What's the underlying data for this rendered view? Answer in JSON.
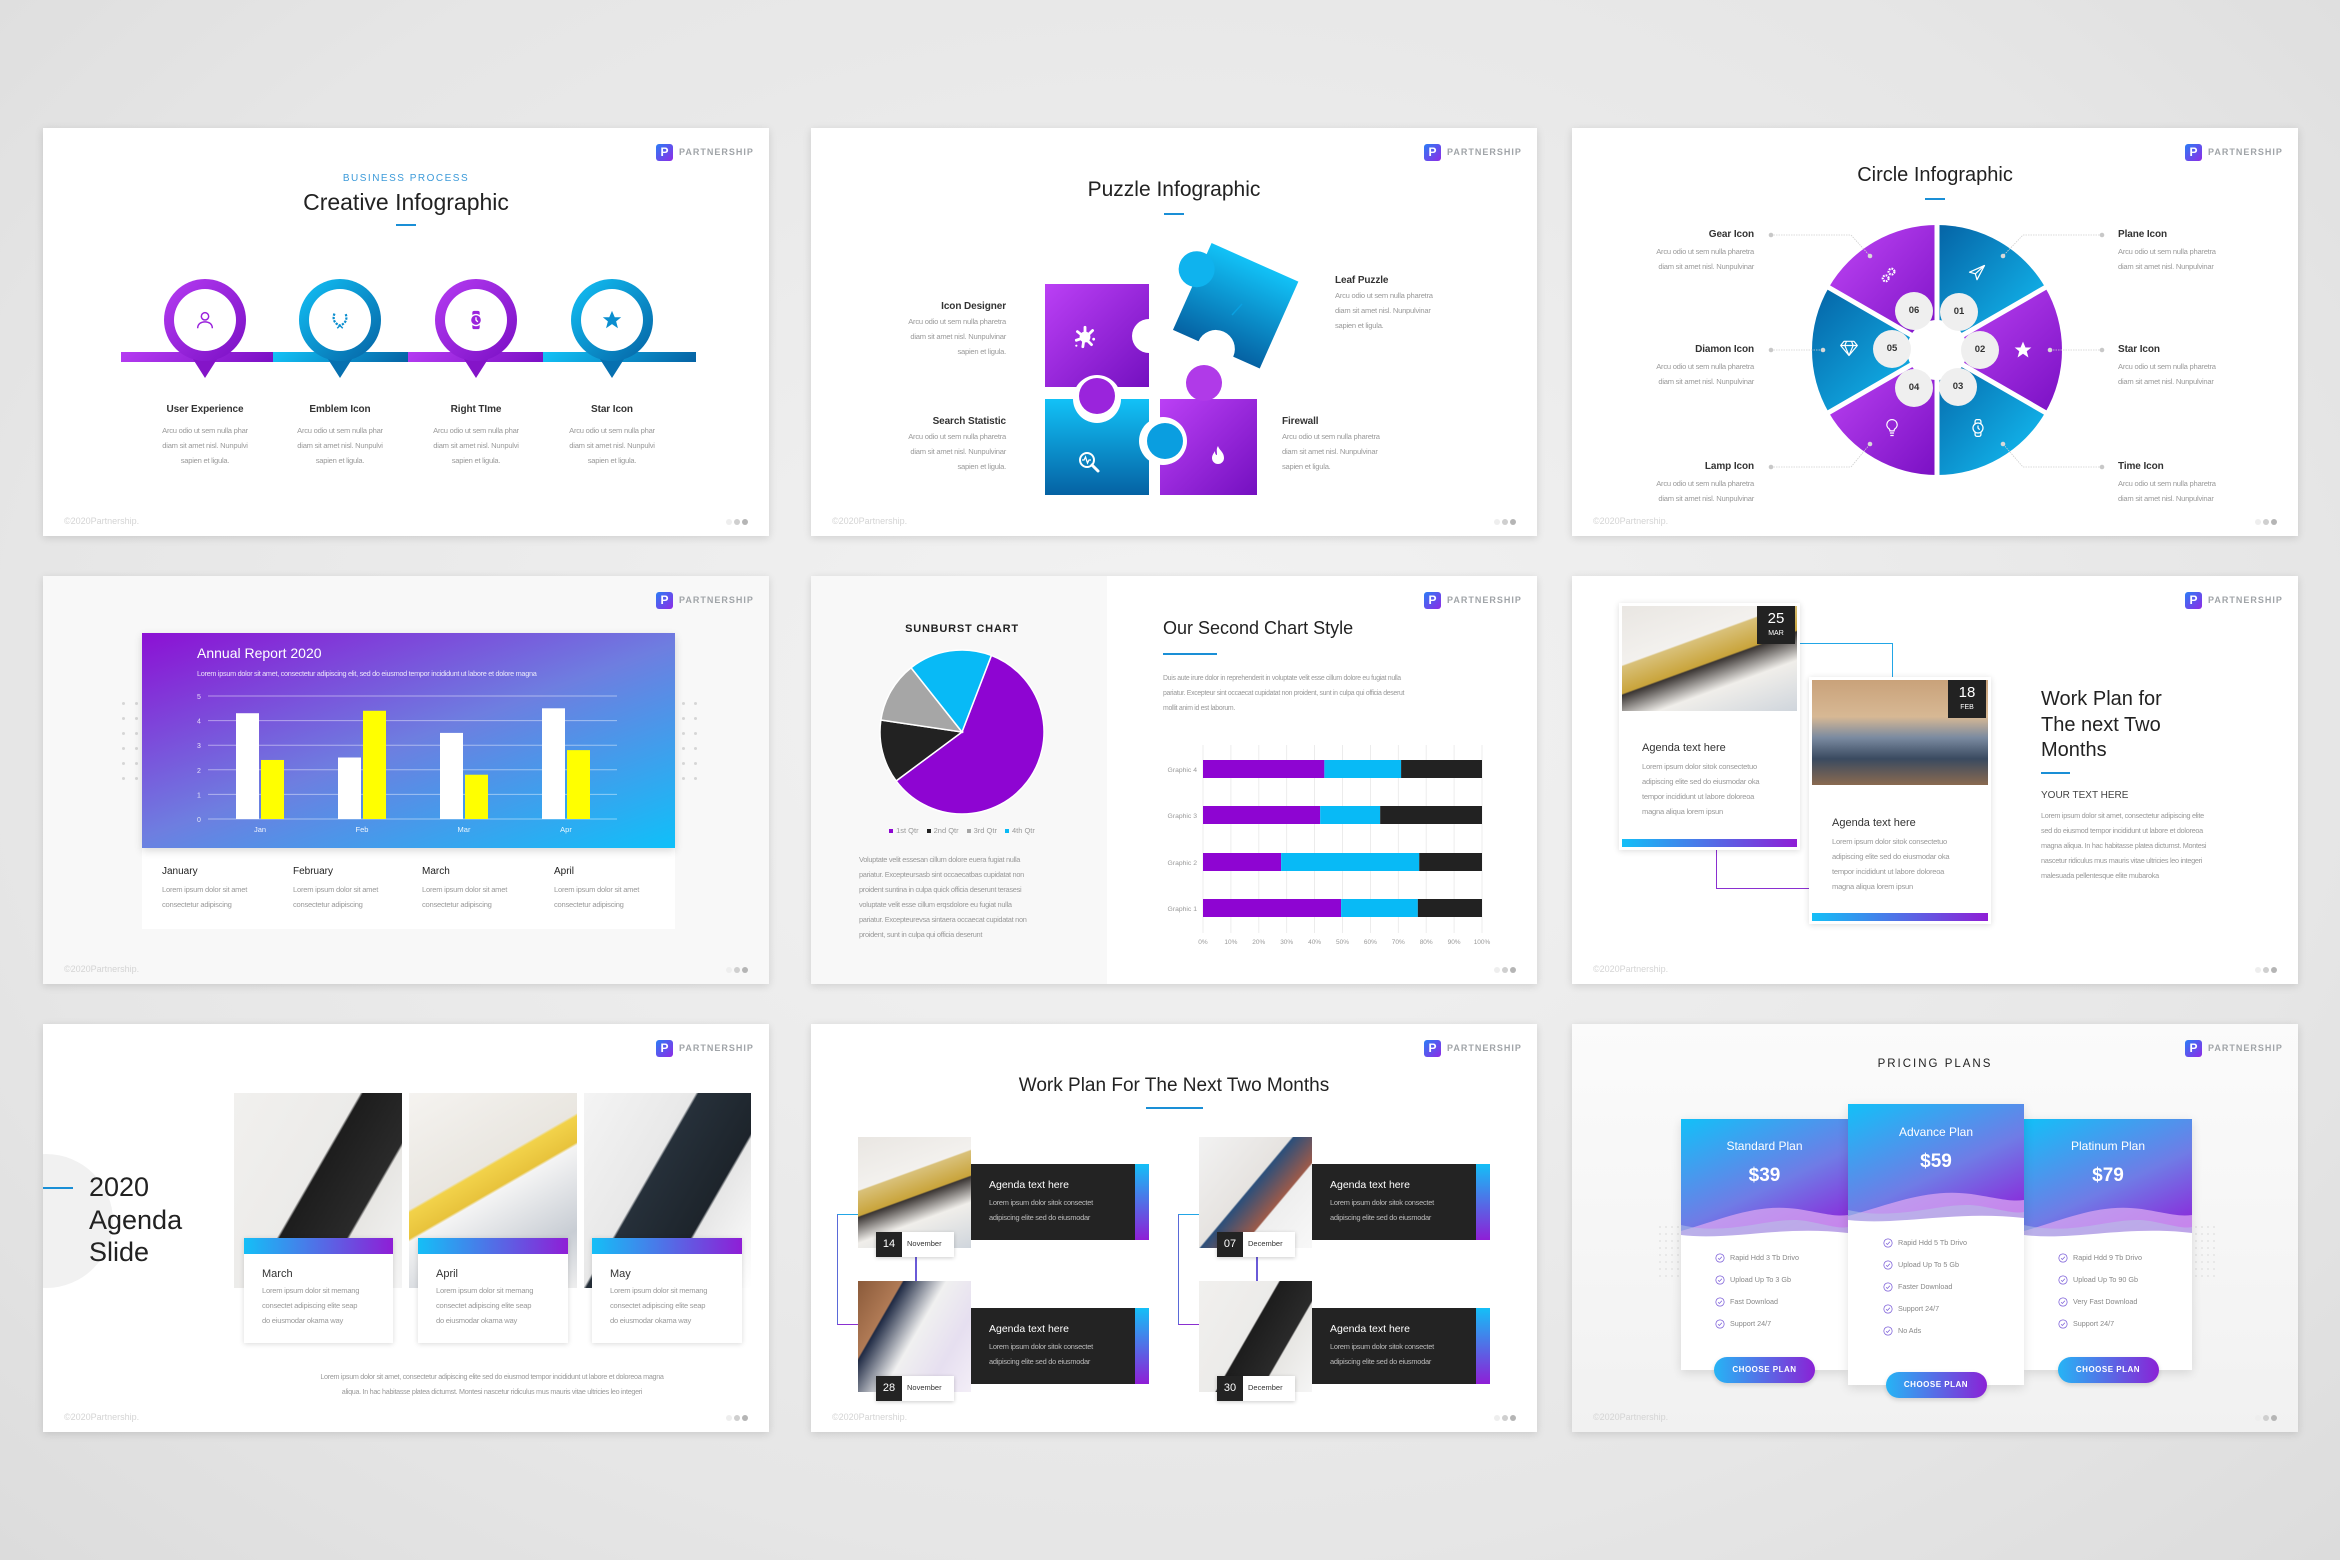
{
  "brand": {
    "logo_letter": "P",
    "name": "PARTNERSHIP",
    "footer": "©2020Partnership."
  },
  "colors": {
    "purple": "#9b1fdc",
    "blue": "#0fbaf3",
    "dark": "#232323",
    "accent_line": "#1a8fd6",
    "yellow": "#ffff00",
    "gray": "#a6a6a6"
  },
  "slides": {
    "creative": {
      "kicker": "BUSINESS PROCESS",
      "title": "Creative Infographic",
      "items": [
        {
          "label": "User Experience",
          "icon": "user-icon",
          "desc": [
            "Arcu odio ut sem nulla phar",
            "diam sit amet nisl. Nunpulvi",
            "sapien et ligula."
          ]
        },
        {
          "label": "Emblem Icon",
          "icon": "emblem-icon",
          "desc": [
            "Arcu odio ut sem nulla phar",
            "diam sit amet nisl. Nunpulvi",
            "sapien et ligula."
          ]
        },
        {
          "label": "Right TIme",
          "icon": "watch-icon",
          "desc": [
            "Arcu odio ut sem nulla phar",
            "diam sit amet nisl. Nunpulvi",
            "sapien et ligula."
          ]
        },
        {
          "label": "Star Icon",
          "icon": "star-icon",
          "desc": [
            "Arcu odio ut sem nulla phar",
            "diam sit amet nisl. Nunpulvi",
            "sapien et ligula."
          ]
        }
      ]
    },
    "puzzle": {
      "title": "Puzzle Infographic",
      "items": [
        {
          "label": "Icon Designer",
          "icon": "splash-icon",
          "desc": [
            "Arcu odio ut sem nulla pharetra",
            "diam sit amet nisl. Nunpulvinar",
            "sapien et ligula."
          ]
        },
        {
          "label": "Search Statistic",
          "icon": "search-icon",
          "desc": [
            "Arcu odio ut sem nulla pharetra",
            "diam sit amet nisl. Nunpulvinar",
            "sapien et ligula."
          ]
        },
        {
          "label": "Leaf Puzzle",
          "icon": "leaf-icon",
          "desc": [
            "Arcu odio ut sem nulla pharetra",
            "diam sit amet nisl. Nunpulvinar",
            "sapien et ligula."
          ]
        },
        {
          "label": "Firewall",
          "icon": "fire-icon",
          "desc": [
            "Arcu odio ut sem nulla pharetra",
            "diam sit amet nisl. Nunpulvinar",
            "sapien et ligula."
          ]
        }
      ]
    },
    "circle": {
      "title": "Circle Infographic",
      "numbers": [
        "01",
        "02",
        "03",
        "04",
        "05",
        "06"
      ],
      "left": [
        {
          "label": "Gear Icon",
          "icon": "gear-icon",
          "desc": [
            "Arcu odio ut sem nulla pharetra",
            "diam sit amet nisl. Nunpulvinar"
          ]
        },
        {
          "label": "Diamon Icon",
          "icon": "diamond-icon",
          "desc": [
            "Arcu odio ut sem nulla pharetra",
            "diam sit amet nisl. Nunpulvinar"
          ]
        },
        {
          "label": "Lamp Icon",
          "icon": "lamp-icon",
          "desc": [
            "Arcu odio ut sem nulla pharetra",
            "diam sit amet nisl. Nunpulvinar"
          ]
        }
      ],
      "right": [
        {
          "label": "Plane Icon",
          "icon": "plane-icon",
          "desc": [
            "Arcu odio ut sem nulla pharetra",
            "diam sit amet nisl. Nunpulvinar"
          ]
        },
        {
          "label": "Star Icon",
          "icon": "star-icon",
          "desc": [
            "Arcu odio ut sem nulla pharetra",
            "diam sit amet nisl. Nunpulvinar"
          ]
        },
        {
          "label": "Time Icon",
          "icon": "watch-icon",
          "desc": [
            "Arcu odio ut sem nulla pharetra",
            "diam sit amet nisl. Nunpulvinar"
          ]
        }
      ]
    },
    "annual": {
      "title": "Annual Report 2020",
      "subtitle": "Lorem ipsum dolor sit amet, consectetur adipiscing elit, sed do eiusmod tempor incididunt ut labore et dolore magna",
      "months": [
        {
          "label": "January",
          "desc": [
            "Lorem ipsum dolor sit amet",
            "consectetur adipiscing"
          ]
        },
        {
          "label": "February",
          "desc": [
            "Lorem ipsum dolor sit amet",
            "consectetur adipiscing"
          ]
        },
        {
          "label": "March",
          "desc": [
            "Lorem ipsum dolor sit amet",
            "consectetur adipiscing"
          ]
        },
        {
          "label": "April",
          "desc": [
            "Lorem ipsum dolor sit amet",
            "consectetur adipiscing"
          ]
        }
      ]
    },
    "charts": {
      "left_paragraph": [
        "Voluptate velit essesan cillum dolore euera fugiat nulla",
        "pariatur. Excepteursasb sint occaecatbas cupidatat non",
        "proident suntina in culpa quick officia deserunt terasesi",
        "voluptate velit esse cillum erqsdolore eu fugiat nulla",
        "pariatur. Excepteurevsa sintaera occaecat cupidatat non",
        "proident, sunt in culpa qui officia deserunt"
      ],
      "right_title": "Our Second Chart Style",
      "right_paragraph": [
        "Duis aute irure dolor in reprehenderit in voluptate velit esse cillum dolore eu fugiat nulla",
        "pariatur. Excepteur sint occaecat cupidatat non proident, sunt in culpa qui officia deserut",
        "mollit anim id est laborum."
      ]
    },
    "workplan": {
      "cards": [
        {
          "day": "25",
          "month": "MAR",
          "heading": "Agenda text here",
          "desc": [
            "Lorem ipsum dolor sitok consectetuo",
            "adipiscing elite sed do eiusmodar oka",
            "tempor incididunt ut labore doloreoa",
            "magna aliqua lorem ipsun"
          ]
        },
        {
          "day": "18",
          "month": "FEB",
          "heading": "Agenda text here",
          "desc": [
            "Lorem ipsum dolor sitok consectetuo",
            "adipiscing elite sed do eiusmodar oka",
            "tempor incididunt ut labore doloreoa",
            "magna aliqua lorem ipsun"
          ]
        }
      ],
      "title": [
        "Work Plan for",
        "The next Two",
        "Months"
      ],
      "subheading": "YOUR TEXT HERE",
      "desc": [
        "Lorem ipsum dolor sit amet, consectetur adipiscing elite",
        "sed do eiusmod tempor incididunt ut labore et doloreoa",
        "magna aliqua. In hac habitasse platea dictumst. Montesi",
        "nascetur ridiculus mus mauris vitae ultricies leo integeri",
        "malesuada pellentesque elite mubaroka"
      ]
    },
    "agenda": {
      "title": [
        "2020",
        "Agenda",
        "Slide"
      ],
      "cards": [
        {
          "label": "March",
          "desc": [
            "Lorem ipsum dolor sit memang",
            "consectet adipiscing elite seap",
            "do eiusmodar okama way"
          ]
        },
        {
          "label": "April",
          "desc": [
            "Lorem ipsum dolor sit memang",
            "consectet adipiscing elite seap",
            "do eiusmodar okama way"
          ]
        },
        {
          "label": "May",
          "desc": [
            "Lorem ipsum dolor sit memang",
            "consectet adipiscing elite seap",
            "do eiusmodar okama way"
          ]
        }
      ],
      "bottom": [
        "Lorem ipsum dolor sit amet, consectetur adipiscing elite sed do eiusmod tempor incididunt ut labore et doloreoa magna",
        "aliqua. In hac habitasse platea dictumst. Montesi nascetur ridiculus mus mauris vitae ultricies leo integeri"
      ]
    },
    "timeline": {
      "title": "Work Plan For The Next Two Months",
      "items": [
        {
          "day": "14",
          "month": "November",
          "heading": "Agenda text here",
          "desc": [
            "Lorem ipsum dolor sitok consectet",
            "adipiscing elite sed do eiusmodar"
          ]
        },
        {
          "day": "28",
          "month": "November",
          "heading": "Agenda text here",
          "desc": [
            "Lorem ipsum dolor sitok consectet",
            "adipiscing elite sed do eiusmodar"
          ]
        },
        {
          "day": "07",
          "month": "December",
          "heading": "Agenda text here",
          "desc": [
            "Lorem ipsum dolor sitok consectet",
            "adipiscing elite sed do eiusmodar"
          ]
        },
        {
          "day": "30",
          "month": "December",
          "heading": "Agenda text here",
          "desc": [
            "Lorem ipsum dolor sitok consectet",
            "adipiscing elite sed do eiusmodar"
          ]
        }
      ]
    },
    "pricing": {
      "title": "PRICING PLANS",
      "plans": [
        {
          "name": "Standard Plan",
          "price": "$39",
          "features": [
            "Rapid Hdd 3 Tb Drivo",
            "Upload Up To 3 Gb",
            "Fast Download",
            "Support 24/7"
          ],
          "button": "CHOOSE PLAN"
        },
        {
          "name": "Advance Plan",
          "price": "$59",
          "features": [
            "Rapid Hdd 5 Tb Drivo",
            "Upload Up To 5 Gb",
            "Faster Download",
            "Support 24/7",
            "No Ads"
          ],
          "button": "CHOOSE PLAN",
          "featured": true
        },
        {
          "name": "Platinum Plan",
          "price": "$79",
          "features": [
            "Rapid Hdd 9 Tb Drivo",
            "Upload Up To 90 Gb",
            "Very Fast Download",
            "Support 24/7"
          ],
          "button": "CHOOSE PLAN"
        }
      ]
    }
  },
  "chart_data": [
    {
      "type": "bar",
      "title": "Annual Report 2020",
      "categories": [
        "Jan",
        "Feb",
        "Mar",
        "Apr"
      ],
      "series": [
        {
          "values": [
            4.3,
            2.5,
            3.5,
            4.5
          ],
          "color": "#ffffff"
        },
        {
          "values": [
            2.4,
            4.4,
            1.8,
            2.8
          ],
          "color": "#ffff00"
        }
      ],
      "ylim": [
        0,
        5
      ],
      "yticks": [
        "0",
        "1",
        "2",
        "3",
        "4",
        "5"
      ],
      "grid": true
    },
    {
      "type": "pie",
      "title": "SUNBURST CHART",
      "categories": [
        "1st Qtr",
        "2nd Qtr",
        "3rd Qtr",
        "4th Qtr"
      ],
      "values": [
        59,
        12.5,
        12,
        16.5
      ],
      "colors": [
        "#8e05d2",
        "#222222",
        "#a6a6a6",
        "#08baf6"
      ],
      "legend": "bottom"
    },
    {
      "type": "bar",
      "orientation": "horizontal-stacked",
      "categories": [
        "Graphic 1",
        "Graphic 2",
        "Graphic 3",
        "Graphic 4"
      ],
      "series": [
        {
          "values": [
            49.5,
            28,
            42,
            43.5
          ],
          "color": "#8e05d2"
        },
        {
          "values": [
            27.5,
            49.5,
            21.5,
            27.5
          ],
          "color": "#08baf6"
        },
        {
          "values": [
            23,
            22.5,
            36.5,
            29
          ],
          "color": "#222222"
        }
      ],
      "xlim": [
        0,
        100
      ],
      "xticks": [
        "0%",
        "10%",
        "20%",
        "30%",
        "40%",
        "50%",
        "60%",
        "70%",
        "80%",
        "90%",
        "100%"
      ],
      "grid": true
    }
  ]
}
